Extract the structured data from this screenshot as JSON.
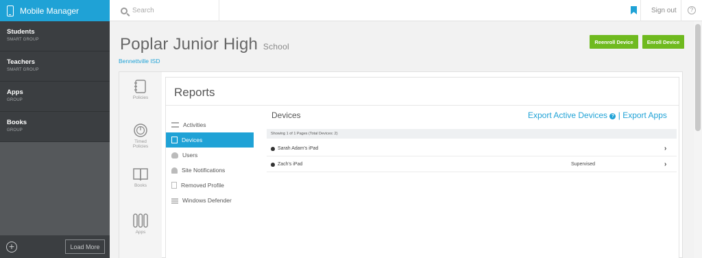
{
  "app": {
    "title": "Mobile Manager"
  },
  "search": {
    "placeholder": "Search"
  },
  "header": {
    "signout_label": "Sign out",
    "help_label": "?"
  },
  "sidebar": {
    "items": [
      {
        "label": "Students",
        "sub": "SMART GROUP"
      },
      {
        "label": "Teachers",
        "sub": "SMART GROUP"
      },
      {
        "label": "Apps",
        "sub": "GROUP"
      },
      {
        "label": "Books",
        "sub": "GROUP"
      }
    ],
    "load_more_label": "Load More"
  },
  "page": {
    "title": "Poplar Junior High",
    "subtitle": "School",
    "district": "Bennettville ISD",
    "reenroll_label": "Reenroll Device",
    "enroll_label": "Enroll Device"
  },
  "icon_nav": [
    {
      "label": "Policies",
      "icon": "policies-icon"
    },
    {
      "label": "Timed\nPolicies",
      "icon": "timed-policies-icon"
    },
    {
      "label": "Books",
      "icon": "books-icon"
    },
    {
      "label": "Apps",
      "icon": "apps-icon"
    }
  ],
  "reports": {
    "title": "Reports",
    "menu": [
      {
        "label": "Activities",
        "active": false
      },
      {
        "label": "Devices",
        "active": true
      },
      {
        "label": "Users",
        "active": false
      },
      {
        "label": "Site Notifications",
        "active": false
      },
      {
        "label": "Removed Profile",
        "active": false
      },
      {
        "label": "Windows Defender",
        "active": false
      }
    ],
    "devices_heading": "Devices",
    "export_active": "Export Active Devices",
    "export_sep": "|",
    "export_apps": "Export Apps",
    "showing": "Showing 1 of 1 Pages (Total Devices: 2)",
    "rows": [
      {
        "name": "Sarah Adam's iPad",
        "status": ""
      },
      {
        "name": "Zach's iPad",
        "status": "Supervised"
      }
    ]
  },
  "colors": {
    "accent": "#1fa2d6",
    "green": "#6fba1f",
    "sidebar": "#3b3e41"
  }
}
